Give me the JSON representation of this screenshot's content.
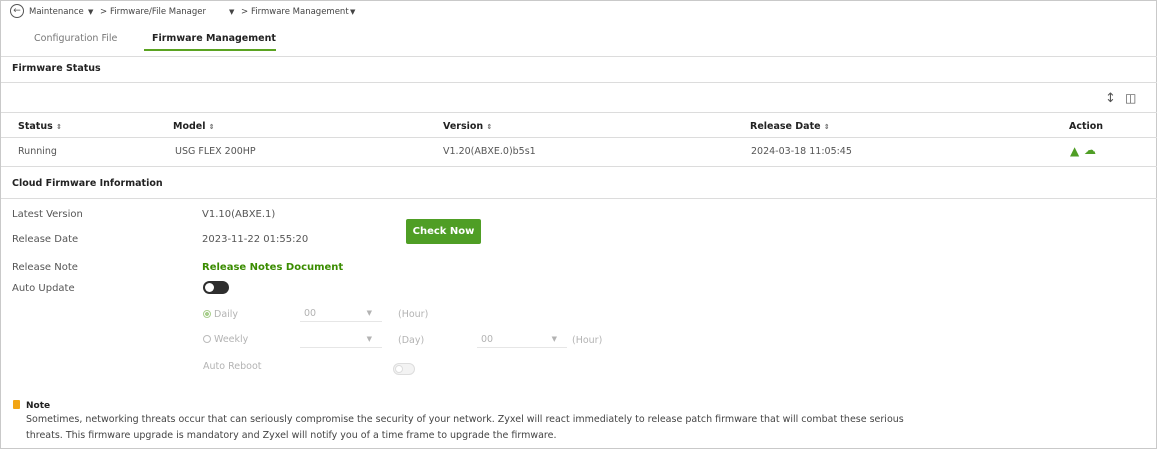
{
  "breadcrumb": {
    "items": [
      "Maintenance",
      ">",
      "Firmware/File Manager",
      ">",
      "Firmware Management"
    ]
  },
  "tabs": [
    {
      "label": "Configuration File",
      "active": false
    },
    {
      "label": "Firmware Management",
      "active": true
    }
  ],
  "firmware_status": {
    "title": "Firmware Status",
    "columns": [
      "Status",
      "Model",
      "Version",
      "Release Date",
      "Action"
    ],
    "rows": [
      {
        "status": "Running",
        "model": "USG FLEX 200HP",
        "version": "V1.20(ABXE.0)b5s1",
        "release_date": "2024-03-18 11:05:45"
      }
    ],
    "action_icons": [
      "download-icon",
      "cloud-upload-icon"
    ],
    "toolbar_icons": [
      "column-height-icon",
      "columns-icon"
    ]
  },
  "cloud": {
    "title": "Cloud Firmware Information",
    "latest_version_label": "Latest Version",
    "latest_version": "V1.10(ABXE.1)",
    "release_date_label": "Release Date",
    "release_date": "2023-11-22 01:55:20",
    "release_note_label": "Release Note",
    "release_note_link": "Release Notes Document",
    "check_now": "Check Now",
    "auto_update_label": "Auto Update",
    "auto_update_enabled": true,
    "daily_label": "Daily",
    "daily_hour": "00",
    "weekly_label": "Weekly",
    "weekly_day": "",
    "weekly_hour": "00",
    "hour_unit": "(Hour)",
    "day_unit": "(Day)",
    "auto_reboot_label": "Auto Reboot",
    "auto_reboot_enabled": false
  },
  "note": {
    "title": "Note",
    "line1": "Sometimes, networking threats occur that can seriously compromise the security of your network. Zyxel will react immediately to release patch firmware that will combat these serious",
    "line2": "threats. This firmware upgrade is mandatory and Zyxel will notify you of a time frame to upgrade the firmware."
  },
  "colors": {
    "accent": "#4f9e25",
    "note": "#f2a515"
  }
}
